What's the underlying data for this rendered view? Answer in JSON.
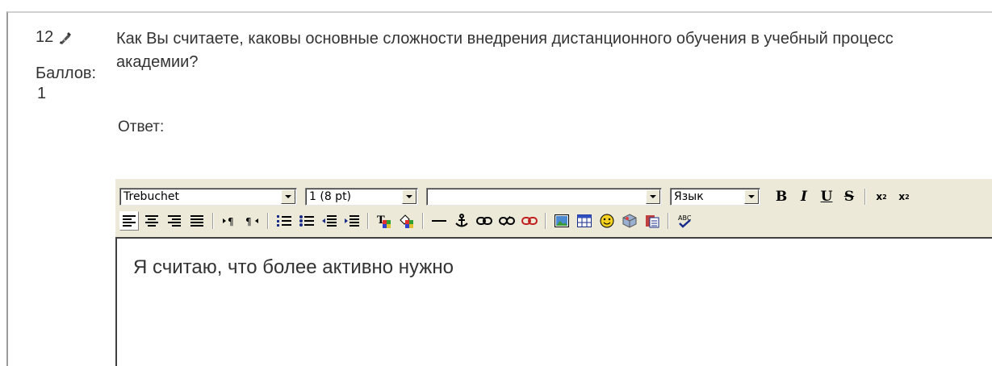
{
  "question": {
    "number": "12",
    "grade_label": "Баллов:",
    "grade_value": "1",
    "text": "Как Вы считаете, каковы основные сложности внедрения дистанционного обучения в учебный процесс академии?",
    "answer_label": "Ответ:"
  },
  "editor": {
    "font_select": "Trebuchet",
    "size_select": "1 (8 pt)",
    "style_select": "",
    "lang_select": "Язык",
    "content_text": "Я считаю, что более активно нужно",
    "buttons_row1": [
      "bold-icon",
      "italic-icon",
      "underline-icon",
      "strikethrough-icon",
      "subscript-icon",
      "superscript-icon"
    ],
    "buttons_row2": [
      "align-left-icon",
      "align-center-icon",
      "align-right-icon",
      "justify-icon",
      "ltr-icon",
      "rtl-icon",
      "ordered-list-icon",
      "unordered-list-icon",
      "outdent-icon",
      "indent-icon",
      "text-color-icon",
      "highlight-color-icon",
      "horizontal-rule-icon",
      "anchor-icon",
      "link-icon",
      "unlink-icon",
      "no-link-icon",
      "image-icon",
      "table-icon",
      "smiley-icon",
      "special-char-icon",
      "paste-icon",
      "spellcheck-icon"
    ]
  },
  "colors": {
    "toolbar_bg": "#ece9d8",
    "frame_border": "#9a9a9a"
  }
}
